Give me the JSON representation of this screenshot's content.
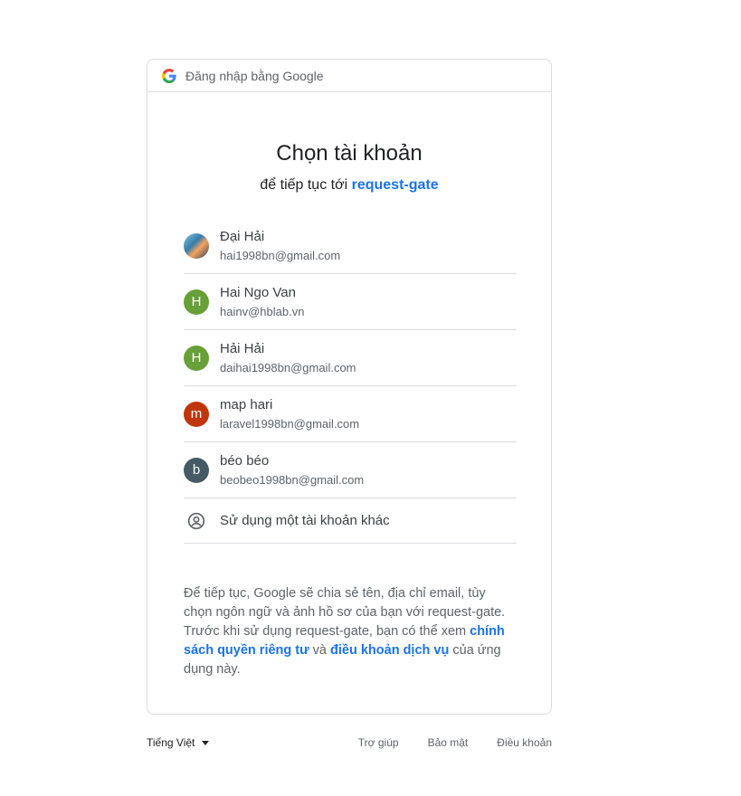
{
  "header": {
    "text": "Đăng nhập bằng Google"
  },
  "main": {
    "title": "Chọn tài khoản",
    "subtitle_prefix": "để tiếp tục tới",
    "app_name": "request-gate"
  },
  "accounts": [
    {
      "name": "Đại Hải",
      "email": "hai1998bn@gmail.com",
      "initial": "",
      "color": ""
    },
    {
      "name": "Hai Ngo Van",
      "email": "hainv@hblab.vn",
      "initial": "H",
      "color": "#689f38"
    },
    {
      "name": "Hải Hải",
      "email": "daihai1998bn@gmail.com",
      "initial": "H",
      "color": "#689f38"
    },
    {
      "name": "map hari",
      "email": "laravel1998bn@gmail.com",
      "initial": "m",
      "color": "#bf360c"
    },
    {
      "name": "béo béo",
      "email": "beobeo1998bn@gmail.com",
      "initial": "b",
      "color": "#455a64"
    }
  ],
  "other_account": {
    "label": "Sử dụng một tài khoản khác",
    "icon": "account-circle-icon"
  },
  "notice": {
    "part1": "Để tiếp tục, Google sẽ chia sẻ tên, địa chỉ email, tùy chọn ngôn ngữ và ảnh hồ sơ của bạn với request-gate. Trước khi sử dụng request-gate, bạn có thể xem",
    "privacy_link": "chính sách quyền riêng tư",
    "and": "và",
    "terms_link": "điều khoản dịch vụ",
    "part2": "của ứng dụng này."
  },
  "footer": {
    "language": "Tiếng Việt",
    "help": "Trợ giúp",
    "privacy": "Bảo mật",
    "terms": "Điều khoản"
  }
}
